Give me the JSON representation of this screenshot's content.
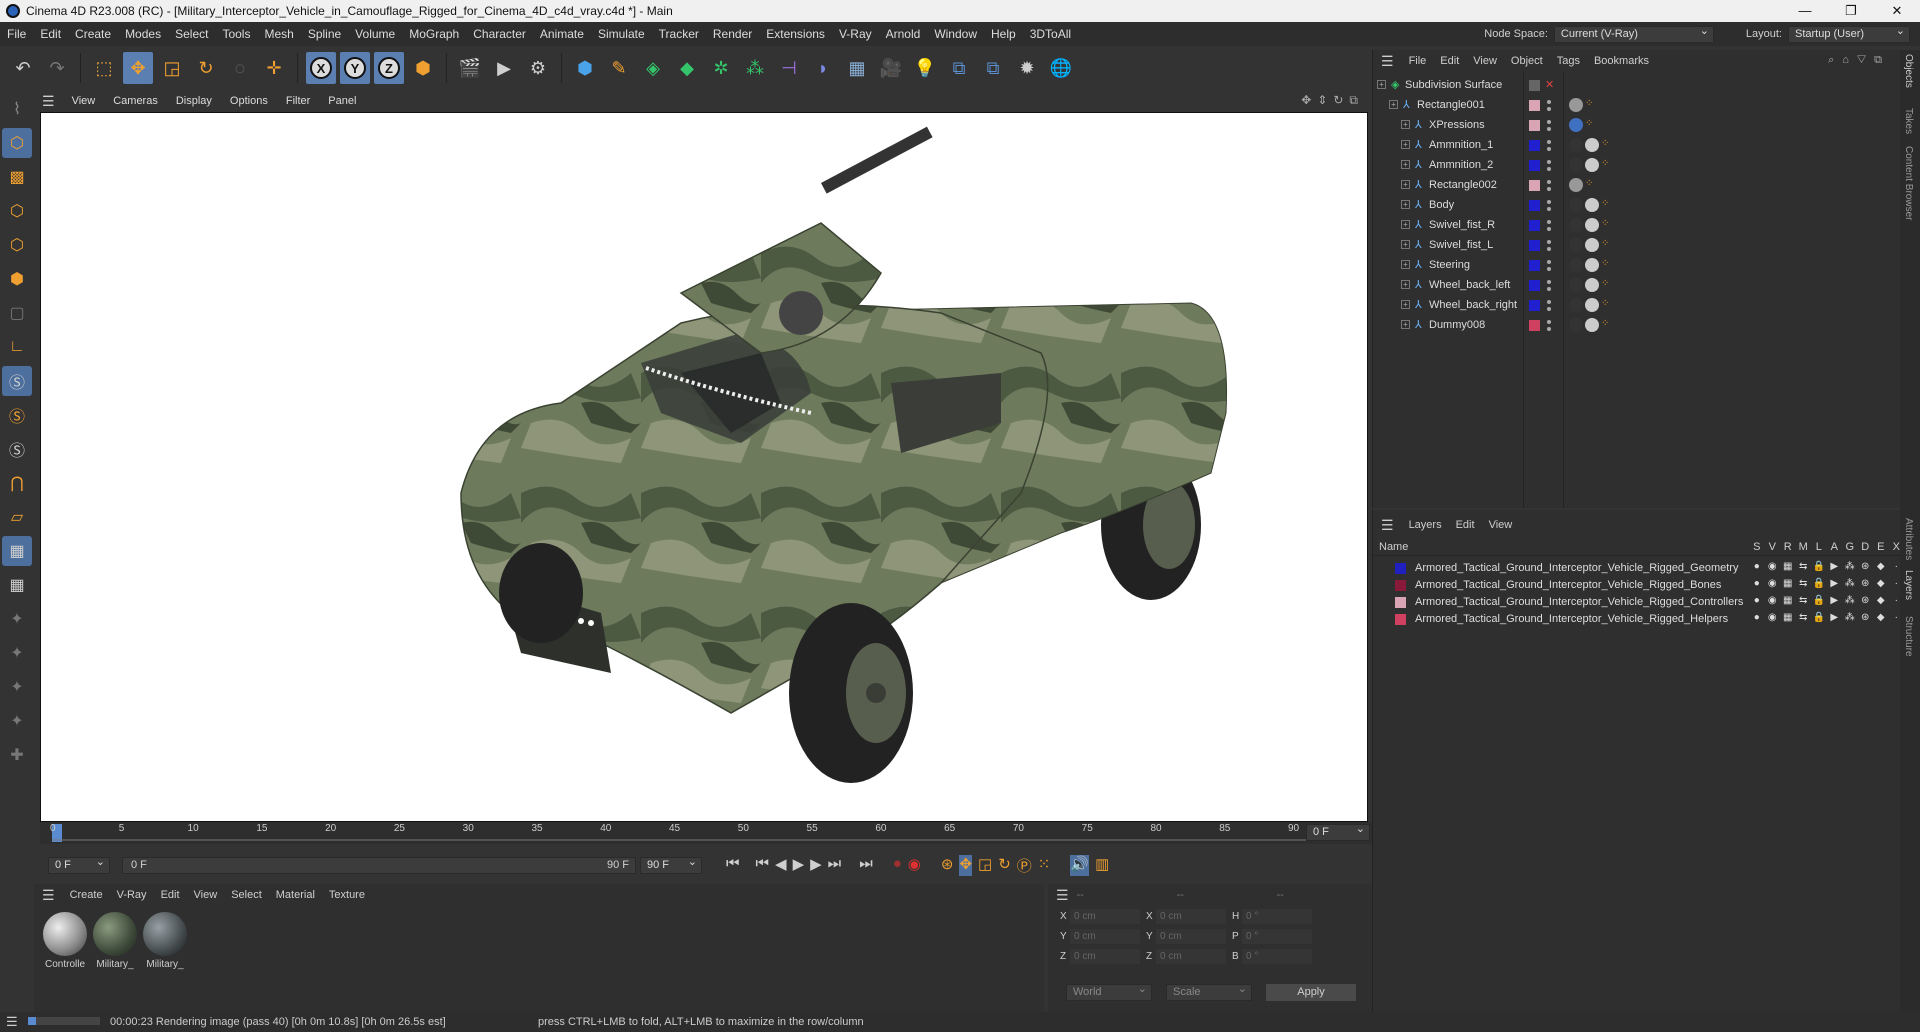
{
  "window": {
    "title": "Cinema 4D R23.008 (RC) - [Military_Interceptor_Vehicle_in_Camouflage_Rigged_for_Cinema_4D_c4d_vray.c4d *] - Main",
    "controls": [
      "—",
      "❐",
      "✕"
    ]
  },
  "menubar": {
    "items": [
      "File",
      "Edit",
      "Create",
      "Modes",
      "Select",
      "Tools",
      "Mesh",
      "Spline",
      "Volume",
      "MoGraph",
      "Character",
      "Animate",
      "Simulate",
      "Tracker",
      "Render",
      "Extensions",
      "V-Ray",
      "Arnold",
      "Window",
      "Help",
      "3DToAll"
    ],
    "node_space_label": "Node Space:",
    "node_space_value": "Current (V-Ray)",
    "layout_label": "Layout:",
    "layout_value": "Startup (User)"
  },
  "viewport": {
    "menu": [
      "View",
      "Cameras",
      "Display",
      "Options",
      "Filter",
      "Panel"
    ]
  },
  "timeline": {
    "ticks": [
      "0",
      "5",
      "10",
      "15",
      "20",
      "25",
      "30",
      "35",
      "40",
      "45",
      "50",
      "55",
      "60",
      "65",
      "70",
      "75",
      "80",
      "85",
      "90"
    ],
    "current_frame": "0 F",
    "start_field": "0 F",
    "range_start": "0 F",
    "range_end": "90 F",
    "end_field": "90 F"
  },
  "materials": {
    "menu": [
      "Create",
      "V-Ray",
      "Edit",
      "View",
      "Select",
      "Material",
      "Texture"
    ],
    "items": [
      {
        "label": "Controlle",
        "color": "#bbbbbb"
      },
      {
        "label": "Military_",
        "color": "#3e4a3a"
      },
      {
        "label": "Military_",
        "color": "#444c4e"
      }
    ]
  },
  "coords": {
    "header_dashes": [
      "--",
      "--",
      "--"
    ],
    "rows": [
      {
        "a": "X",
        "av": "0 cm",
        "b": "X",
        "bv": "0 cm",
        "c": "H",
        "cv": "0 °"
      },
      {
        "a": "Y",
        "av": "0 cm",
        "b": "Y",
        "bv": "0 cm",
        "c": "P",
        "cv": "0 °"
      },
      {
        "a": "Z",
        "av": "0 cm",
        "b": "Z",
        "bv": "0 cm",
        "c": "B",
        "cv": "0 °"
      }
    ],
    "world": "World",
    "scale": "Scale",
    "apply": "Apply"
  },
  "status": {
    "time": "00:00:23 Rendering image (pass 40) [0h  0m 10.8s] [0h  0m 26.5s est]",
    "hint": "press CTRL+LMB to fold, ALT+LMB to maximize in the row/column",
    "progress": 0.11
  },
  "objects": {
    "menu": [
      "File",
      "Edit",
      "View",
      "Object",
      "Tags",
      "Bookmarks"
    ],
    "rows": [
      {
        "name": "Subdivision Surface",
        "color": "",
        "indent": 0
      },
      {
        "name": "Rectangle001",
        "color": "#d9a4b4",
        "indent": 1
      },
      {
        "name": "XPressions",
        "color": "#d9a4b4",
        "indent": 2
      },
      {
        "name": "Ammnition_1",
        "color": "#2020d0",
        "indent": 2
      },
      {
        "name": "Ammnition_2",
        "color": "#2020d0",
        "indent": 2
      },
      {
        "name": "Rectangle002",
        "color": "#d9a4b4",
        "indent": 2
      },
      {
        "name": "Body",
        "color": "#2020d0",
        "indent": 2
      },
      {
        "name": "Swivel_fist_R",
        "color": "#2020d0",
        "indent": 2
      },
      {
        "name": "Swivel_fist_L",
        "color": "#2020d0",
        "indent": 2
      },
      {
        "name": "Steering",
        "color": "#2020d0",
        "indent": 2
      },
      {
        "name": "Wheel_back_left",
        "color": "#2020d0",
        "indent": 2
      },
      {
        "name": "Wheel_back_right",
        "color": "#2020d0",
        "indent": 2
      },
      {
        "name": "Dummy008",
        "color": "#d04060",
        "indent": 2
      }
    ]
  },
  "layers": {
    "menu": [
      "Layers",
      "Edit",
      "View"
    ],
    "header_name": "Name",
    "columns": [
      "S",
      "V",
      "R",
      "M",
      "L",
      "A",
      "G",
      "D",
      "E",
      "X"
    ],
    "rows": [
      {
        "name": "Armored_Tactical_Ground_Interceptor_Vehicle_Rigged_Geometry",
        "color": "#2020c0"
      },
      {
        "name": "Armored_Tactical_Ground_Interceptor_Vehicle_Rigged_Bones",
        "color": "#8a1a3a"
      },
      {
        "name": "Armored_Tactical_Ground_Interceptor_Vehicle_Rigged_Controllers",
        "color": "#d9a4b4"
      },
      {
        "name": "Armored_Tactical_Ground_Interceptor_Vehicle_Rigged_Helpers",
        "color": "#d04060"
      }
    ]
  },
  "sidetabs": [
    "Objects",
    "Takes",
    "Content Browser",
    "Attributes",
    "Layers",
    "Structure"
  ]
}
